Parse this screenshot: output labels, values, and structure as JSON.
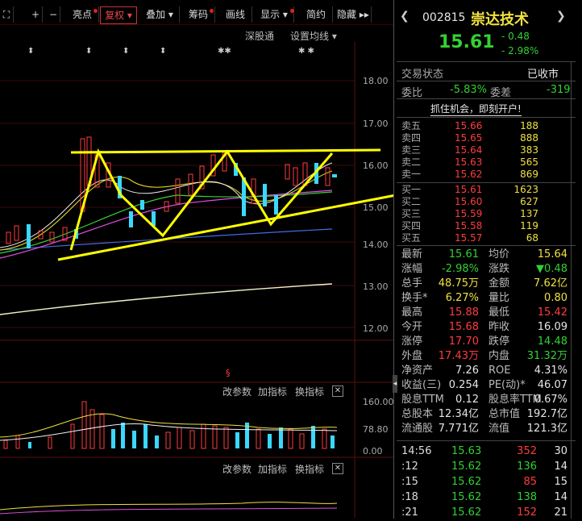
{
  "toolbar": {
    "items": [
      "亮点",
      "复权",
      "叠加",
      "筹码",
      "画线",
      "显示",
      "简约",
      "隐藏"
    ]
  },
  "chart_header": {
    "link1": "深股通",
    "link2": "设置均线"
  },
  "price_axis": [
    "18.00",
    "17.00",
    "16.00",
    "15.00",
    "14.00",
    "13.00",
    "12.00"
  ],
  "indicator_panel1": {
    "btn1": "改参数",
    "btn2": "加指标",
    "btn3": "换指标",
    "axis": [
      "160.00",
      "78.80",
      "0.00"
    ]
  },
  "indicator_panel2": {
    "btn1": "改参数",
    "btn2": "加指标",
    "btn3": "换指标"
  },
  "stock": {
    "code": "002815",
    "name": "崇达技术",
    "price": "15.61",
    "change": "- 0.48",
    "change_pct": "- 2.98%"
  },
  "status": {
    "label": "交易状态",
    "value": "已收市"
  },
  "weibi": {
    "label1": "委比",
    "value1": "-5.83%",
    "label2": "委差",
    "value2": "-319"
  },
  "promo": "抓住机会，即刻开户!",
  "asks": [
    {
      "label": "卖五",
      "price": "15.66",
      "vol": "188"
    },
    {
      "label": "卖四",
      "price": "15.65",
      "vol": "888"
    },
    {
      "label": "卖三",
      "price": "15.64",
      "vol": "383"
    },
    {
      "label": "卖二",
      "price": "15.63",
      "vol": "565"
    },
    {
      "label": "卖一",
      "price": "15.62",
      "vol": "869"
    }
  ],
  "bids": [
    {
      "label": "买一",
      "price": "15.61",
      "vol": "1623"
    },
    {
      "label": "买二",
      "price": "15.60",
      "vol": "627"
    },
    {
      "label": "买三",
      "price": "15.59",
      "vol": "137"
    },
    {
      "label": "买四",
      "price": "15.58",
      "vol": "119"
    },
    {
      "label": "买五",
      "price": "15.57",
      "vol": "68"
    }
  ],
  "stats": [
    {
      "l1": "最新",
      "v1": "15.61",
      "l2": "均价",
      "v2": "15.64"
    },
    {
      "l1": "涨幅",
      "v1": "-2.98%",
      "l2": "涨跌",
      "v2": "▼0.48"
    },
    {
      "l1": "总手",
      "v1": "48.75万",
      "l2": "金额",
      "v2": "7.62亿"
    },
    {
      "l1": "换手*",
      "v1": "6.27%",
      "l2": "量比",
      "v2": "0.80"
    },
    {
      "l1": "最高",
      "v1": "15.88",
      "l2": "最低",
      "v2": "15.42"
    },
    {
      "l1": "今开",
      "v1": "15.68",
      "l2": "昨收",
      "v2": "16.09"
    },
    {
      "l1": "涨停",
      "v1": "17.70",
      "l2": "跌停",
      "v2": "14.48"
    },
    {
      "l1": "外盘",
      "v1": "17.43万",
      "l2": "内盘",
      "v2": "31.32万"
    },
    {
      "l1": "净资产",
      "v1": "7.26",
      "l2": "ROE",
      "v2": "4.31%"
    },
    {
      "l1": "收益(三)",
      "v1": "0.254",
      "l2": "PE(动)*",
      "v2": "46.07"
    },
    {
      "l1": "股息TTM",
      "v1": "0.12",
      "l2": "股息率TTM",
      "v2": "0.67%"
    },
    {
      "l1": "总股本",
      "v1": "12.34亿",
      "l2": "总市值",
      "v2": "192.7亿"
    },
    {
      "l1": "流通股",
      "v1": "7.771亿",
      "l2": "流值",
      "v2": "121.3亿"
    }
  ],
  "ticks": [
    {
      "time": "14:56",
      "price": "15.63",
      "vol": "352",
      "n": "30"
    },
    {
      "time": ":12",
      "price": "15.62",
      "vol": "136",
      "n": "14"
    },
    {
      "time": ":15",
      "price": "15.62",
      "vol": "85",
      "n": "15"
    },
    {
      "time": ":18",
      "price": "15.62",
      "vol": "138",
      "n": "14"
    },
    {
      "time": ":21",
      "price": "15.62",
      "vol": "152",
      "n": "21"
    }
  ],
  "marker_s": "S",
  "colors": {
    "up": "#ff3c3c",
    "down": "#33d133",
    "accent": "#f0e040",
    "bg": "#000000"
  }
}
